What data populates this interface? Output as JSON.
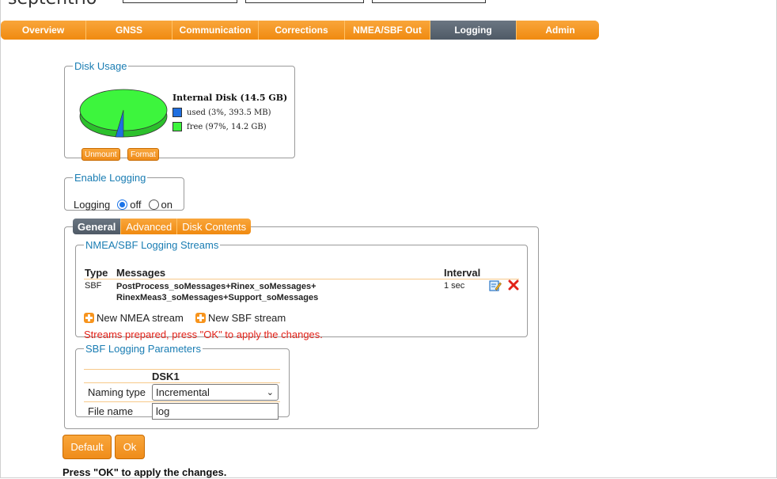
{
  "header": {
    "brand": "septentrio"
  },
  "nav": {
    "tabs": [
      {
        "label": "Overview",
        "active": false
      },
      {
        "label": "GNSS",
        "active": false
      },
      {
        "label": "Communication",
        "active": false
      },
      {
        "label": "Corrections",
        "active": false
      },
      {
        "label": "NMEA/SBF Out",
        "active": false
      },
      {
        "label": "Logging",
        "active": true
      },
      {
        "label": "Admin",
        "active": false
      }
    ]
  },
  "disk_usage": {
    "legend": "Disk Usage",
    "title": "Internal Disk (14.5 GB)",
    "used_label": "used (3%, 393.5 MB)",
    "free_label": "free (97%, 14.2 GB)",
    "used_fraction": 0.03,
    "used_color": "#1f6fe0",
    "free_color": "#3df53d",
    "unmount_label": "Unmount",
    "format_label": "Format"
  },
  "enable_logging": {
    "legend": "Enable Logging",
    "label": "Logging",
    "off_label": "off",
    "on_label": "on",
    "selected": "off"
  },
  "subtabs": [
    {
      "label": "General",
      "active": true
    },
    {
      "label": "Advanced",
      "active": false
    },
    {
      "label": "Disk Contents",
      "active": false
    }
  ],
  "streams": {
    "legend": "NMEA/SBF Logging Streams",
    "headers": {
      "type": "Type",
      "messages": "Messages",
      "interval": "Interval"
    },
    "rows": [
      {
        "type": "SBF",
        "messages_line1": "PostProcess_soMessages+Rinex_soMessages+",
        "messages_line2": "RinexMeas3_soMessages+Support_soMessages",
        "interval": "1 sec"
      }
    ],
    "new_nmea": "New NMEA stream",
    "new_sbf": "New SBF stream",
    "warning": "Streams prepared, press \"OK\" to apply the changes."
  },
  "sbf_params": {
    "legend": "SBF Logging Parameters",
    "column": "DSK1",
    "naming_label": "Naming type",
    "naming_value": "Incremental",
    "file_label": "File name",
    "file_value": "log"
  },
  "buttons": {
    "default": "Default",
    "ok": "Ok"
  },
  "footer": "Press \"OK\" to apply the changes."
}
